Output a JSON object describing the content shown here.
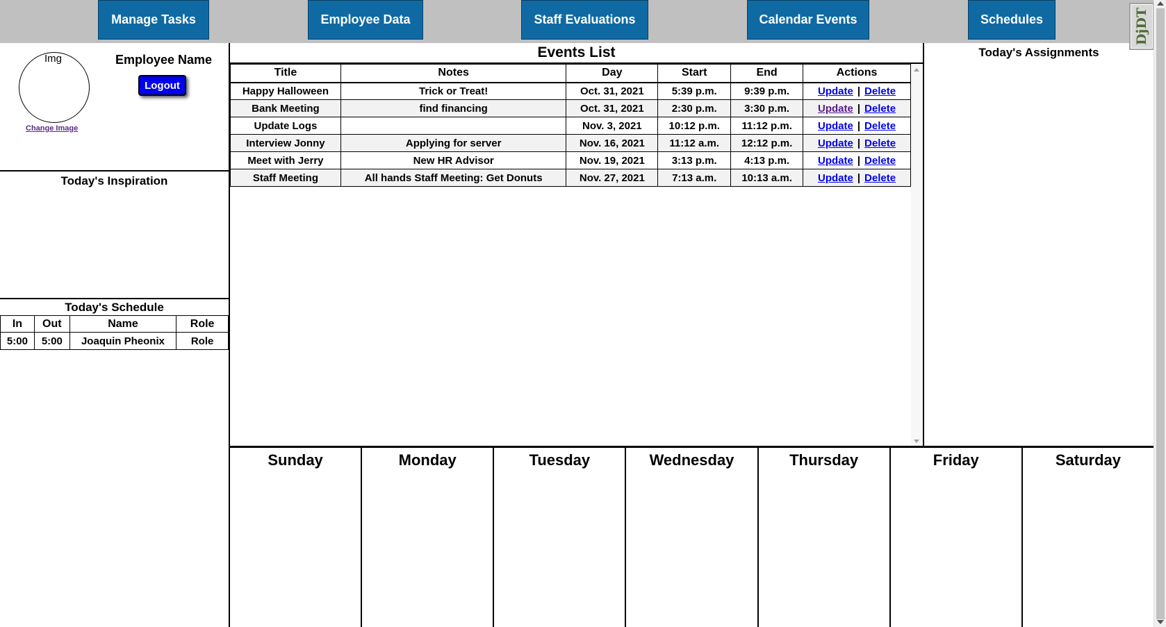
{
  "nav": {
    "items": [
      {
        "label": "Manage Tasks"
      },
      {
        "label": "Employee Data"
      },
      {
        "label": "Staff Evaluations"
      },
      {
        "label": "Calendar Events"
      },
      {
        "label": "Schedules"
      }
    ],
    "logo_text": "DjDT",
    "color": "#0f6aa4"
  },
  "profile": {
    "img_placeholder": "Img",
    "change_image": "Change Image",
    "employee_name": "Employee Name",
    "logout": "Logout"
  },
  "inspiration": {
    "title": "Today's Inspiration"
  },
  "schedule": {
    "title": "Today's Schedule",
    "columns": [
      "In",
      "Out",
      "Name",
      "Role"
    ],
    "rows": [
      {
        "in": "5:00",
        "out": "5:00",
        "name": "Joaquin Pheonix",
        "role": "Role"
      }
    ]
  },
  "events": {
    "title": "Events List",
    "columns": [
      "Title",
      "Notes",
      "Day",
      "Start",
      "End",
      "Actions"
    ],
    "update_label": "Update",
    "delete_label": "Delete",
    "separator": "|",
    "rows": [
      {
        "title": "Happy Halloween",
        "notes": "Trick or Treat!",
        "day": "Oct. 31, 2021",
        "start": "5:39 p.m.",
        "end": "9:39 p.m."
      },
      {
        "title": "Bank Meeting",
        "notes": "find financing",
        "day": "Oct. 31, 2021",
        "start": "2:30 p.m.",
        "end": "3:30 p.m."
      },
      {
        "title": "Update Logs",
        "notes": "",
        "day": "Nov. 3, 2021",
        "start": "10:12 p.m.",
        "end": "11:12 p.m."
      },
      {
        "title": "Interview Jonny",
        "notes": "Applying for server",
        "day": "Nov. 16, 2021",
        "start": "11:12 a.m.",
        "end": "12:12 p.m."
      },
      {
        "title": "Meet with Jerry",
        "notes": "New HR Advisor",
        "day": "Nov. 19, 2021",
        "start": "3:13 p.m.",
        "end": "4:13 p.m."
      },
      {
        "title": "Staff Meeting",
        "notes": "All hands Staff Meeting: Get Donuts",
        "day": "Nov. 27, 2021",
        "start": "7:13 a.m.",
        "end": "10:13 a.m."
      }
    ]
  },
  "assignments": {
    "title": "Today's Assignments"
  },
  "week": {
    "days": [
      "Sunday",
      "Monday",
      "Tuesday",
      "Wednesday",
      "Thursday",
      "Friday",
      "Saturday"
    ]
  }
}
